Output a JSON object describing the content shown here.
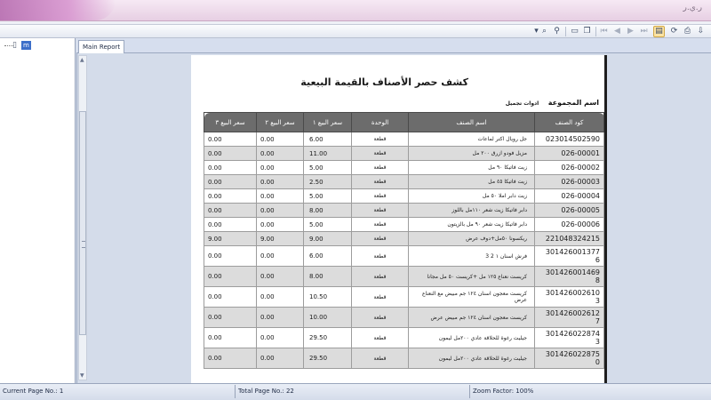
{
  "window": {
    "title_right": "ر.ي.ر"
  },
  "toolbar": {
    "buttons": [
      {
        "name": "thumbnails-dropdown-icon",
        "glyph": "▾"
      },
      {
        "name": "find-icon",
        "glyph": "⌕"
      },
      {
        "name": "find-next-icon",
        "glyph": "⚲"
      },
      {
        "name": "prev-window-icon",
        "glyph": "▭"
      },
      {
        "name": "copy-icon",
        "glyph": "❐"
      },
      {
        "name": "first-page-icon",
        "glyph": "⏮"
      },
      {
        "name": "previous-page-icon",
        "glyph": "◀"
      },
      {
        "name": "next-page-icon",
        "glyph": "▶"
      },
      {
        "name": "last-page-icon",
        "glyph": "⏭"
      },
      {
        "name": "page-setup-icon",
        "glyph": "▤"
      },
      {
        "name": "refresh-icon",
        "glyph": "⟳"
      },
      {
        "name": "print-icon",
        "glyph": "⎙"
      },
      {
        "name": "export-icon",
        "glyph": "⇩"
      }
    ]
  },
  "tree": {
    "node_label": "m"
  },
  "tabs": {
    "main_report": "Main Report"
  },
  "report": {
    "title": "كشف حصر الأصناف بالقيمة البيعية",
    "group_label": "اسم المجموعة",
    "group_value": "ادوات تجميل",
    "columns": [
      "كود الصنف",
      "اسم الصنف",
      "الوحدة",
      "سعر البيع ١",
      "سعر البيع ٢",
      "سعر البيع ٣"
    ],
    "rows": [
      {
        "code": "023014502590",
        "name": "جل رويال اكتر لماعات",
        "unit": "قطعة",
        "p1": "6.00",
        "p2": "0.00",
        "p3": "0.00"
      },
      {
        "code": "026-00001",
        "name": "مزيل فودو ازرق ٢٠٠ مل",
        "unit": "قطعة",
        "p1": "11.00",
        "p2": "0.00",
        "p3": "0.00"
      },
      {
        "code": "026-00002",
        "name": "زيت فاتيكا ٩٠ مل",
        "unit": "قطعة",
        "p1": "5.00",
        "p2": "0.00",
        "p3": "0.00"
      },
      {
        "code": "026-00003",
        "name": "زيت فاتيكا ٤٥ مل",
        "unit": "قطعة",
        "p1": "2.50",
        "p2": "0.00",
        "p3": "0.00"
      },
      {
        "code": "026-00004",
        "name": "زيت دابر املا ٥٠ مل",
        "unit": "قطعة",
        "p1": "5.00",
        "p2": "0.00",
        "p3": "0.00"
      },
      {
        "code": "026-00005",
        "name": "دابر فاتيكا زيت شعر ١١٠مل باللوز",
        "unit": "قطعة",
        "p1": "8.00",
        "p2": "0.00",
        "p3": "0.00"
      },
      {
        "code": "026-00006",
        "name": "دابر فاتيكا زيت شعر ٩٠ مل بالزيتون",
        "unit": "قطعة",
        "p1": "5.00",
        "p2": "0.00",
        "p3": "0.00"
      },
      {
        "code": "221048324215",
        "name": "ريكسونا ٥٠مل+دوف عرض",
        "unit": "قطعة",
        "p1": "9.00",
        "p2": "9.00",
        "p3": "9.00"
      },
      {
        "code": "3014260013776",
        "code_line1": "301426001377",
        "code_line2": "6",
        "name": "فرش اسنان ١ 2 3",
        "unit": "قطعة",
        "p1": "6.00",
        "p2": "0.00",
        "p3": "0.00"
      },
      {
        "code": "3014260014698",
        "code_line1": "301426001469",
        "code_line2": "8",
        "name": "كريست نعناع ١٢٥ مل +كريست ٥٠ مل مجانا",
        "unit": "قطعة",
        "p1": "8.00",
        "p2": "0.00",
        "p3": "0.00"
      },
      {
        "code": "3014260026103",
        "code_line1": "301426002610",
        "code_line2": "3",
        "name": "كريست معجون اسنان ١٢٤ جم مبيض مع النعناع عرض",
        "unit": "قطعة",
        "p1": "10.50",
        "p2": "0.00",
        "p3": "0.00"
      },
      {
        "code": "3014260026127",
        "code_line1": "301426002612",
        "code_line2": "7",
        "name": "كريست معجون اسنان ١٢٤ جم مبيض عرض",
        "unit": "قطعة",
        "p1": "10.00",
        "p2": "0.00",
        "p3": "0.00"
      },
      {
        "code": "3014260228743",
        "code_line1": "301426022874",
        "code_line2": "3",
        "name": "جيليت رغوة للحلاقة عادي ٢٠٠مل ليمون",
        "unit": "قطعة",
        "p1": "29.50",
        "p2": "0.00",
        "p3": "0.00"
      },
      {
        "code": "3014260228750",
        "code_line1": "301426022875",
        "code_line2": "0",
        "name": "جيليت رغوة للحلاقة عادي ٢٠٠مل ليمون",
        "unit": "قطعة",
        "p1": "29.50",
        "p2": "0.00",
        "p3": "0.00"
      }
    ]
  },
  "status": {
    "current_page": "Current Page No.: 1",
    "total_page": "Total Page No.: 22",
    "zoom": "Zoom Factor: 100%"
  }
}
